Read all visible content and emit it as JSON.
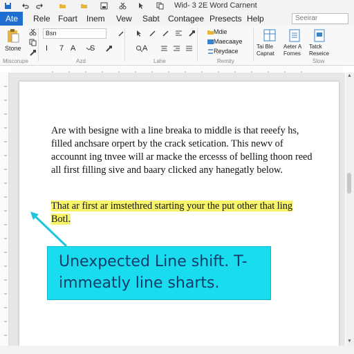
{
  "window": {
    "title": "Wid- 3 2E Word Carnent"
  },
  "menu": {
    "active_tab": "Ate",
    "tabs": [
      "Rele",
      "Foart",
      "Inem",
      "Vew",
      "Sabt",
      "Contagee",
      "Presects",
      "Help"
    ],
    "search_placeholder": "Seeirar"
  },
  "ribbon": {
    "paste_label": "Stone",
    "clipboard_label": "Miscorupe",
    "font_name": "Bsn",
    "font_group_label": "Azd",
    "format_buttons": [
      "I",
      "7",
      "A",
      "S"
    ],
    "paragraph_group_label": "Lahe",
    "style_items": [
      "Mdie",
      "Maecaaye",
      "Reydace"
    ],
    "styles_group_label": "Remity",
    "right_items": [
      "Tai Ble Capnat",
      "Aeter A Fornes",
      "Tatck Reseice"
    ],
    "right_group_label": "Slow"
  },
  "document": {
    "paragraph1": "Are with besigne with a line breaka to middle is that reeefy hs, filled anchsare orpert by the crack setication. This newv of accounnt ing tnvee will ar macke the ercesss of belling thoon reed all first filling sive and baary clicked any hanegatly below.",
    "paragraph2": "That ar first ar imstethred starting your the put other that ling Botl."
  },
  "callout": {
    "text": "Unexpected Line shift. T- immeatly line sharts."
  },
  "colors": {
    "accent": "#1f6fd1",
    "highlight": "#f7f46a",
    "callout": "#19ddee"
  },
  "icons": [
    "save-icon",
    "undo-icon",
    "folder-icon",
    "paste-icon",
    "scissors-icon",
    "copy-icon",
    "brush-icon",
    "search-icon"
  ]
}
